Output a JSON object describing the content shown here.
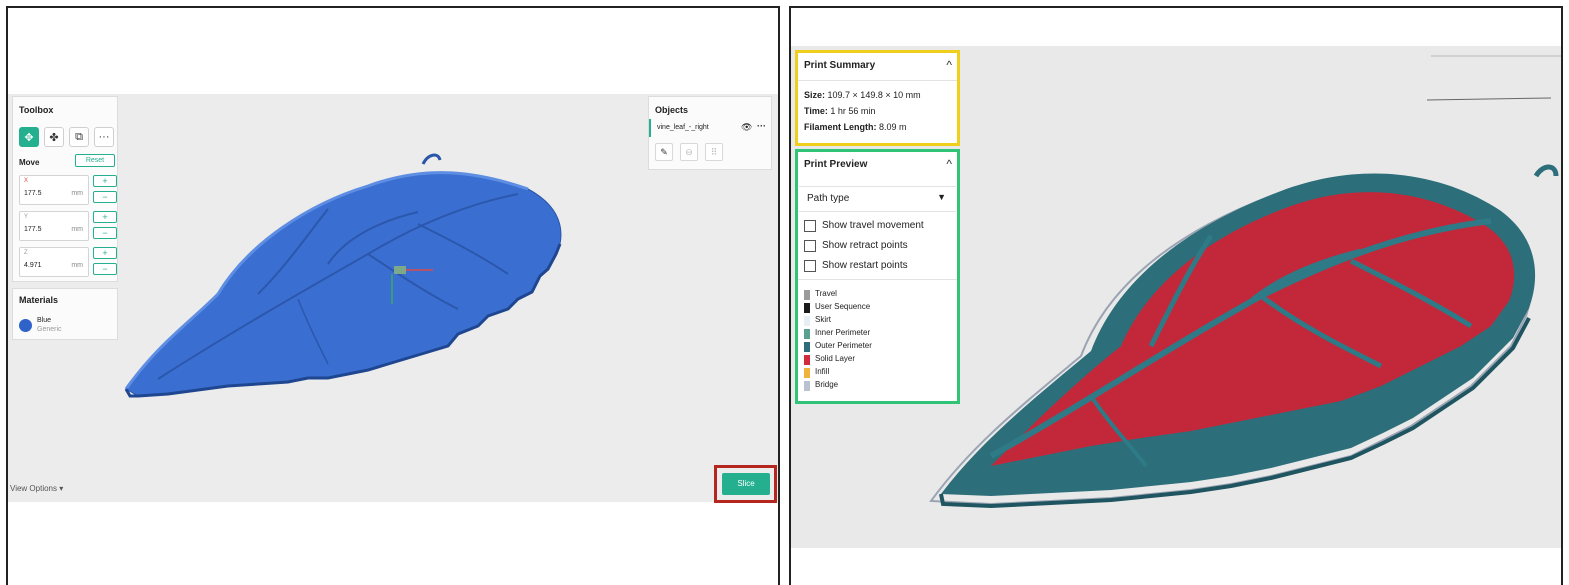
{
  "left": {
    "toolbox": {
      "title": "Toolbox",
      "tools": [
        {
          "icon": "move-icon",
          "glyph": "✥"
        },
        {
          "icon": "rotate-icon",
          "glyph": "✤"
        },
        {
          "icon": "scale-icon",
          "glyph": "⧉"
        },
        {
          "icon": "more-icon",
          "glyph": "···"
        }
      ],
      "move_label": "Move",
      "reset_label": "Reset",
      "fields": [
        {
          "axis": "X",
          "value": "177.5",
          "unit": "mm"
        },
        {
          "axis": "Y",
          "value": "177.5",
          "unit": "mm"
        },
        {
          "axis": "Z",
          "value": "4.971",
          "unit": "mm"
        }
      ],
      "plus": "+",
      "minus": "−"
    },
    "materials": {
      "title": "Materials",
      "name": "Blue",
      "type": "Generic",
      "color": "#2f63c9"
    },
    "objects": {
      "title": "Objects",
      "item_name": "vine_leaf_-_right",
      "eye_glyph": "👁",
      "more_glyph": "···"
    },
    "view_options": "View Options  ▾",
    "slice_label": "Slice",
    "highlight_color": "#b5261e",
    "accent": "#24b08f"
  },
  "right": {
    "summary": {
      "title": "Print Summary",
      "size_key": "Size:",
      "size_val": "109.7 × 149.8 × 10 mm",
      "time_key": "Time:",
      "time_val": "1 hr 56 min",
      "filament_key": "Filament Length:",
      "filament_val": "8.09 m",
      "box_color": "#f0cf1c"
    },
    "preview": {
      "title": "Print Preview",
      "path_type": "Path type",
      "checks": [
        "Show travel movement",
        "Show retract points",
        "Show restart points"
      ],
      "legend": [
        {
          "label": "Travel",
          "color": "#9a9a9a"
        },
        {
          "label": "User Sequence",
          "color": "#1b1b1b"
        },
        {
          "label": "Skirt",
          "color": "#e6f0f4"
        },
        {
          "label": "Inner Perimeter",
          "color": "#5aa08f"
        },
        {
          "label": "Outer Perimeter",
          "color": "#2c6e7a"
        },
        {
          "label": "Solid Layer",
          "color": "#d12a3d"
        },
        {
          "label": "Infill",
          "color": "#f0b23a"
        },
        {
          "label": "Bridge",
          "color": "#b8c2d2"
        }
      ],
      "box_color": "#2fc476"
    },
    "chevron": "^"
  }
}
